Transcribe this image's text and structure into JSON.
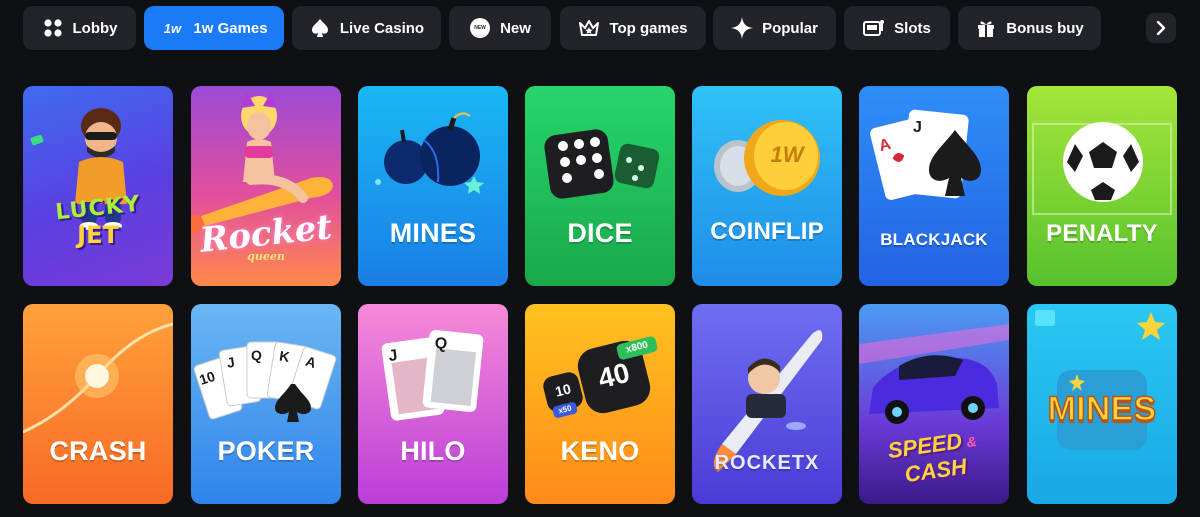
{
  "nav": {
    "items": [
      {
        "label": "Lobby",
        "icon": "grid-icon",
        "active": false
      },
      {
        "label": "1w Games",
        "icon": "1w-logo-icon",
        "active": true
      },
      {
        "label": "Live Casino",
        "icon": "spade-icon",
        "active": false
      },
      {
        "label": "New",
        "icon": "new-badge-icon",
        "active": false
      },
      {
        "label": "Top games",
        "icon": "crown-icon",
        "active": false
      },
      {
        "label": "Popular",
        "icon": "sparkle-icon",
        "active": false
      },
      {
        "label": "Slots",
        "icon": "slot-machine-icon",
        "active": false
      },
      {
        "label": "Bonus buy",
        "icon": "gift-icon",
        "active": false
      }
    ],
    "icon_1w_text": "1w",
    "new_badge_text": "NEW",
    "next_icon": "chevron-right-icon"
  },
  "games": [
    {
      "id": "lucky-jet",
      "logo_line1": "LUCKY",
      "logo_line2": "JET"
    },
    {
      "id": "rocket-queen",
      "logo_line1": "Rocket",
      "logo_line2": "queen"
    },
    {
      "id": "mines",
      "title": "MINES"
    },
    {
      "id": "dice",
      "title": "DICE"
    },
    {
      "id": "coinflip",
      "title": "COINFLIP",
      "coin_text": "1W"
    },
    {
      "id": "blackjack",
      "title": "BLACKJACK"
    },
    {
      "id": "penalty",
      "title": "PENALTY"
    },
    {
      "id": "crash",
      "title": "CRASH"
    },
    {
      "id": "poker",
      "title": "POKER",
      "cards": [
        "10",
        "J",
        "Q",
        "K",
        "A"
      ]
    },
    {
      "id": "hilo",
      "title": "HILO",
      "cards": [
        "J",
        "Q"
      ]
    },
    {
      "id": "keno",
      "title": "KENO",
      "balls": [
        "40",
        "10"
      ],
      "badges": [
        "x800",
        "x50"
      ]
    },
    {
      "id": "rocket-x",
      "title": "ROCKETX"
    },
    {
      "id": "speed-and-cash",
      "logo_line1": "SPEED",
      "logo_amp": "&",
      "logo_line2": "CASH"
    },
    {
      "id": "mines-2",
      "title": "MINES"
    }
  ],
  "colors": {
    "background": "#0f1013",
    "nav_button": "#22242a",
    "nav_active": "#1a7af8"
  }
}
